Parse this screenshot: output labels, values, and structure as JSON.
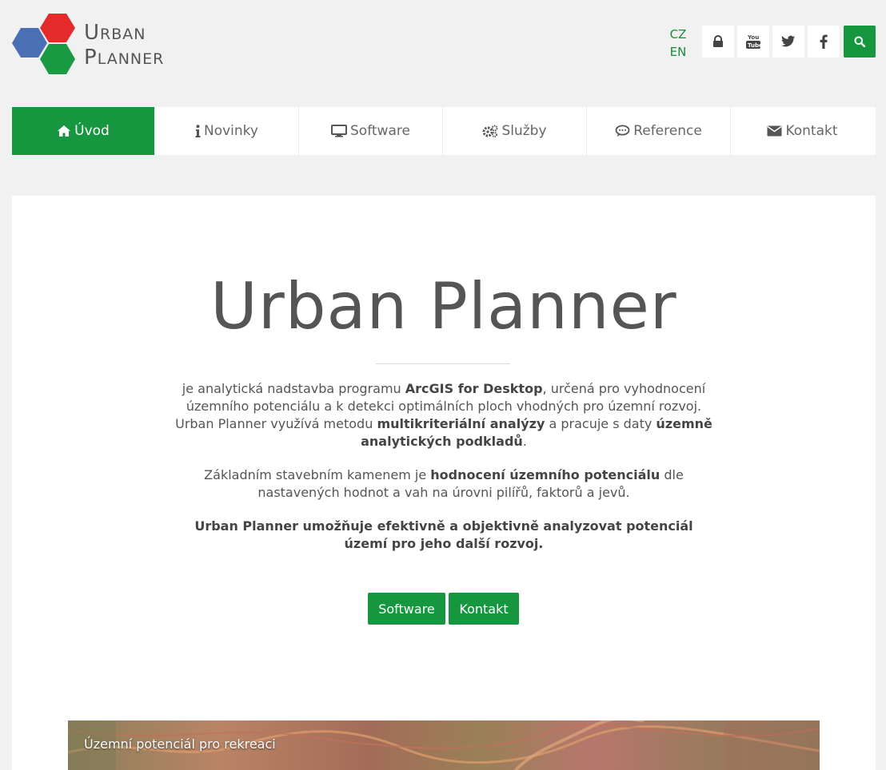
{
  "brand": {
    "line1_cap": "U",
    "line1_rest": "RBAN",
    "line2_cap": "P",
    "line2_rest": "LANNER",
    "hex_colors": [
      "#e32b2b",
      "#4a6fb5",
      "#1a9a43"
    ]
  },
  "header": {
    "languages": [
      "CZ",
      "EN"
    ],
    "icons": [
      "lock-icon",
      "youtube-icon",
      "twitter-icon",
      "facebook-icon",
      "search-icon"
    ],
    "accent": "#15963f"
  },
  "nav": {
    "items": [
      {
        "label": "Úvod",
        "icon": "home-icon",
        "active": true
      },
      {
        "label": "Novinky",
        "icon": "info-icon",
        "active": false
      },
      {
        "label": "Software",
        "icon": "monitor-icon",
        "active": false
      },
      {
        "label": "Služby",
        "icon": "gears-icon",
        "active": false
      },
      {
        "label": "Reference",
        "icon": "comment-icon",
        "active": false
      },
      {
        "label": "Kontakt",
        "icon": "envelope-icon",
        "active": false
      }
    ]
  },
  "hero": {
    "title": "Urban Planner",
    "p1": {
      "t1": "je analytická nadstavba programu ",
      "b1": "ArcGIS for Desktop",
      "t2": ", určená pro vyhodnocení územního potenciálu a k detekci optimálních ploch vhodných pro územní rozvoj. Urban Planner využívá metodu ",
      "b2": "multikriteriální analýzy",
      "t3": " a pracuje s daty ",
      "b3": "územně analytických podkladů",
      "t4": "."
    },
    "p2": {
      "t1": "Základním stavebním kamenem je ",
      "b1": "hodnocení územního potenciálu",
      "t2": " dle nastavených hodnot a vah na úrovni pilířů, faktorů a jevů."
    },
    "p3": "Urban Planner umožňuje efektivně a objektivně analyzovat potenciál území pro jeho další rozvoj.",
    "buttons": {
      "software": "Software",
      "kontakt": "Kontakt"
    }
  },
  "map": {
    "caption": "Územní potenciál pro rekreaci"
  }
}
